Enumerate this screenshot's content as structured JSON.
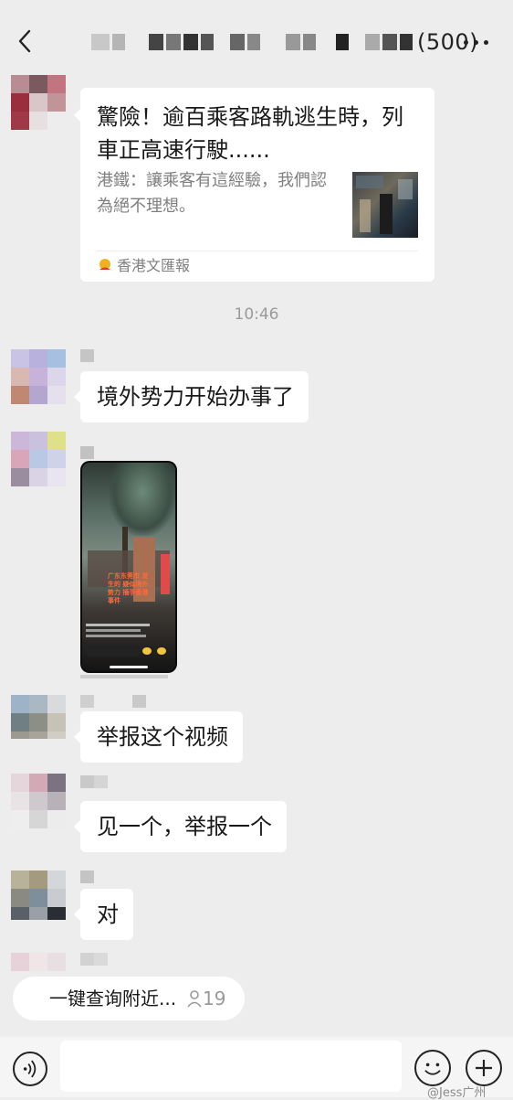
{
  "header": {
    "title_count": "(500)",
    "back_icon": "chevron-left-icon",
    "more_icon": "more-dots-icon"
  },
  "messages": [
    {
      "type": "link_card",
      "title": "驚險！逾百乘客路軌逃生時，列車正高速行駛......",
      "description": "港鐵：讓乘客有這經驗，我們認為絕不理想。",
      "source": "香港文匯報"
    },
    {
      "type": "time",
      "text": "10:46"
    },
    {
      "type": "text",
      "text": "境外势力开始办事了"
    },
    {
      "type": "image",
      "caption": "广东东莞市\n发生的\n疑似境外势力\n插手香港事件"
    },
    {
      "type": "text",
      "text": "举报这个视频"
    },
    {
      "type": "text",
      "text": "见一个，举报一个"
    },
    {
      "type": "text",
      "text": "对"
    }
  ],
  "quick_action": {
    "label": "一键查询附近...",
    "count": "19",
    "icon": "person-icon"
  },
  "input_bar": {
    "placeholder": "",
    "voice_icon": "voice-icon",
    "emoji_icon": "emoji-icon",
    "plus_icon": "plus-icon"
  },
  "watermark": "@Jess广州",
  "colors": {
    "background": "#ededed",
    "bubble": "#ffffff",
    "muted_text": "#7f7f7f"
  }
}
